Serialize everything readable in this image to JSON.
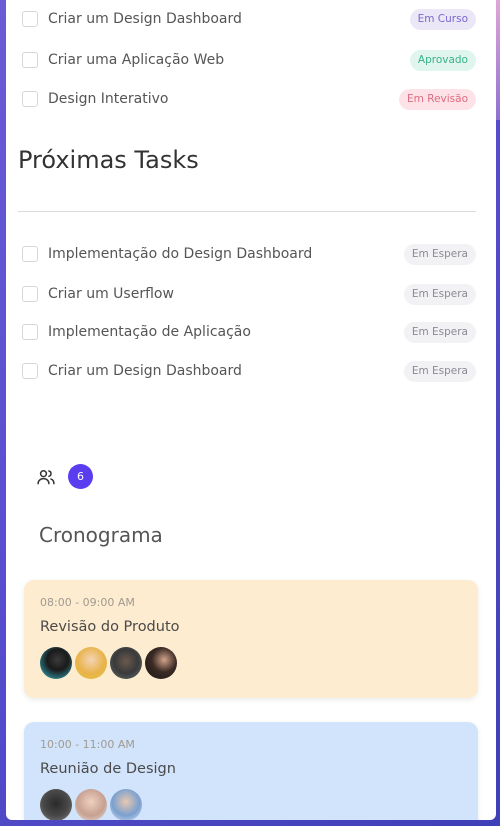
{
  "current_tasks": [
    {
      "label": "Criar um Design Dashboard",
      "status": "Em Curso",
      "status_type": "curso"
    },
    {
      "label": "Criar uma Aplicação Web",
      "status": "Aprovado",
      "status_type": "aprovado"
    },
    {
      "label": "Design Interativo",
      "status": "Em Revisão",
      "status_type": "revisao"
    }
  ],
  "next_tasks_section": {
    "title": "Próximas Tasks",
    "items": [
      {
        "label": "Implementação do Design Dashboard",
        "status": "Em Espera"
      },
      {
        "label": "Criar um Userflow",
        "status": "Em Espera"
      },
      {
        "label": "Implementação de Aplicação",
        "status": "Em Espera"
      },
      {
        "label": "Criar um Design Dashboard",
        "status": "Em Espera"
      }
    ]
  },
  "team": {
    "icon": "users-icon",
    "count": "6"
  },
  "schedule": {
    "title": "Cronograma",
    "events": [
      {
        "time": "08:00 - 09:00 AM",
        "title": "Revisão do Produto",
        "color": "#fdeccf"
      },
      {
        "time": "10:00 - 11:00 AM",
        "title": "Reunião de Design",
        "color": "#d2e4fb"
      }
    ]
  },
  "colors": {
    "accent": "#5b3df0",
    "em_curso": "#7b68d0",
    "aprovado": "#38b189",
    "em_revisao": "#e06b80",
    "em_espera": "#8a8a96"
  }
}
